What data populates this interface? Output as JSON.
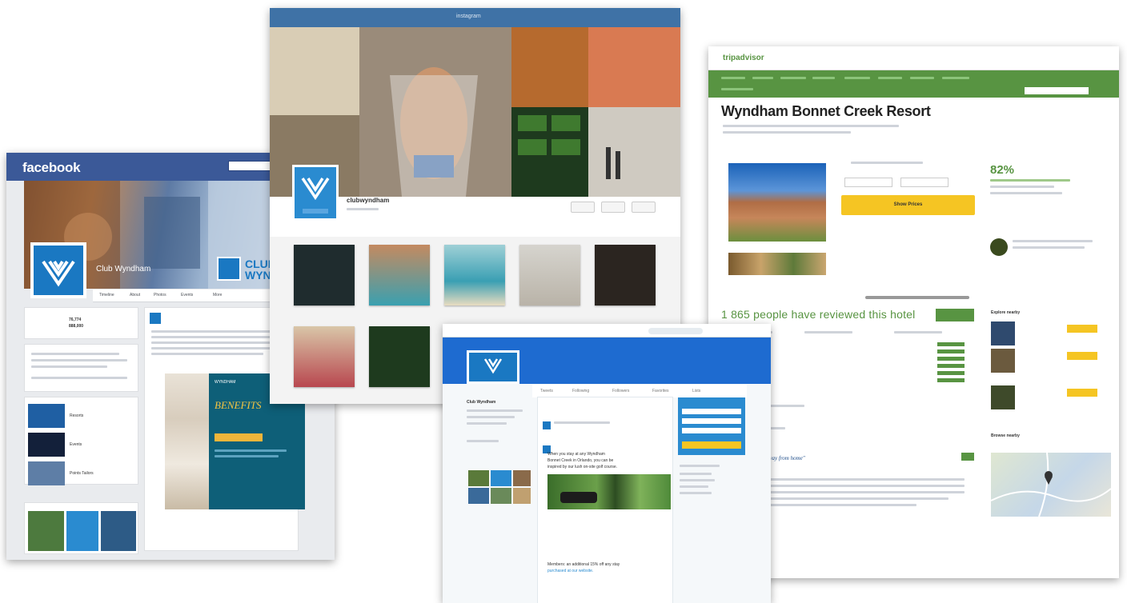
{
  "facebook": {
    "logo": "facebook",
    "page_name": "Club Wyndham",
    "cover_brand": "CLUB\nWYN",
    "tabs": [
      "Timeline",
      "About",
      "Photos",
      "Events",
      "More"
    ],
    "stats": {
      "likes": "76,774",
      "talking": "888,000"
    },
    "albums": [
      "Resorts",
      "Events",
      "Points Tailors"
    ],
    "ad": {
      "tagline": "WYNDHAM",
      "headline": "BENEFITS"
    }
  },
  "instagram": {
    "title": "instagram",
    "username": "clubwyndham"
  },
  "tripadvisor": {
    "logo_prefix": "trip",
    "logo_suffix": "advisor",
    "hotel_name": "Wyndham Bonnet Creek Resort",
    "button": "Show Prices",
    "score": "82%",
    "reviewed": "1 865 people have reviewed this hotel",
    "map_title": "Browse nearby",
    "travel_section": "Explore nearby",
    "quote": "\"Stay living while away from home\""
  },
  "twitter": {
    "account": "Club Wyndham",
    "nav": [
      "Tweets",
      "Following",
      "Followers",
      "Favorites",
      "Lists"
    ],
    "tweets": [
      "When you stay at any Wyndham",
      "Bonnet Creek in Orlando, you can be",
      "inspired by our lush on-site golf course.",
      "Members: an additional 15% off any stay",
      "purchased at our website."
    ]
  },
  "colors": {
    "facebook": "#3b5998",
    "twitter": "#1e6bd0",
    "tripadvisor": "#589442",
    "instagram": "#3f72a6",
    "wyndham": "#1a78c2",
    "button_yellow": "#f5c523"
  }
}
